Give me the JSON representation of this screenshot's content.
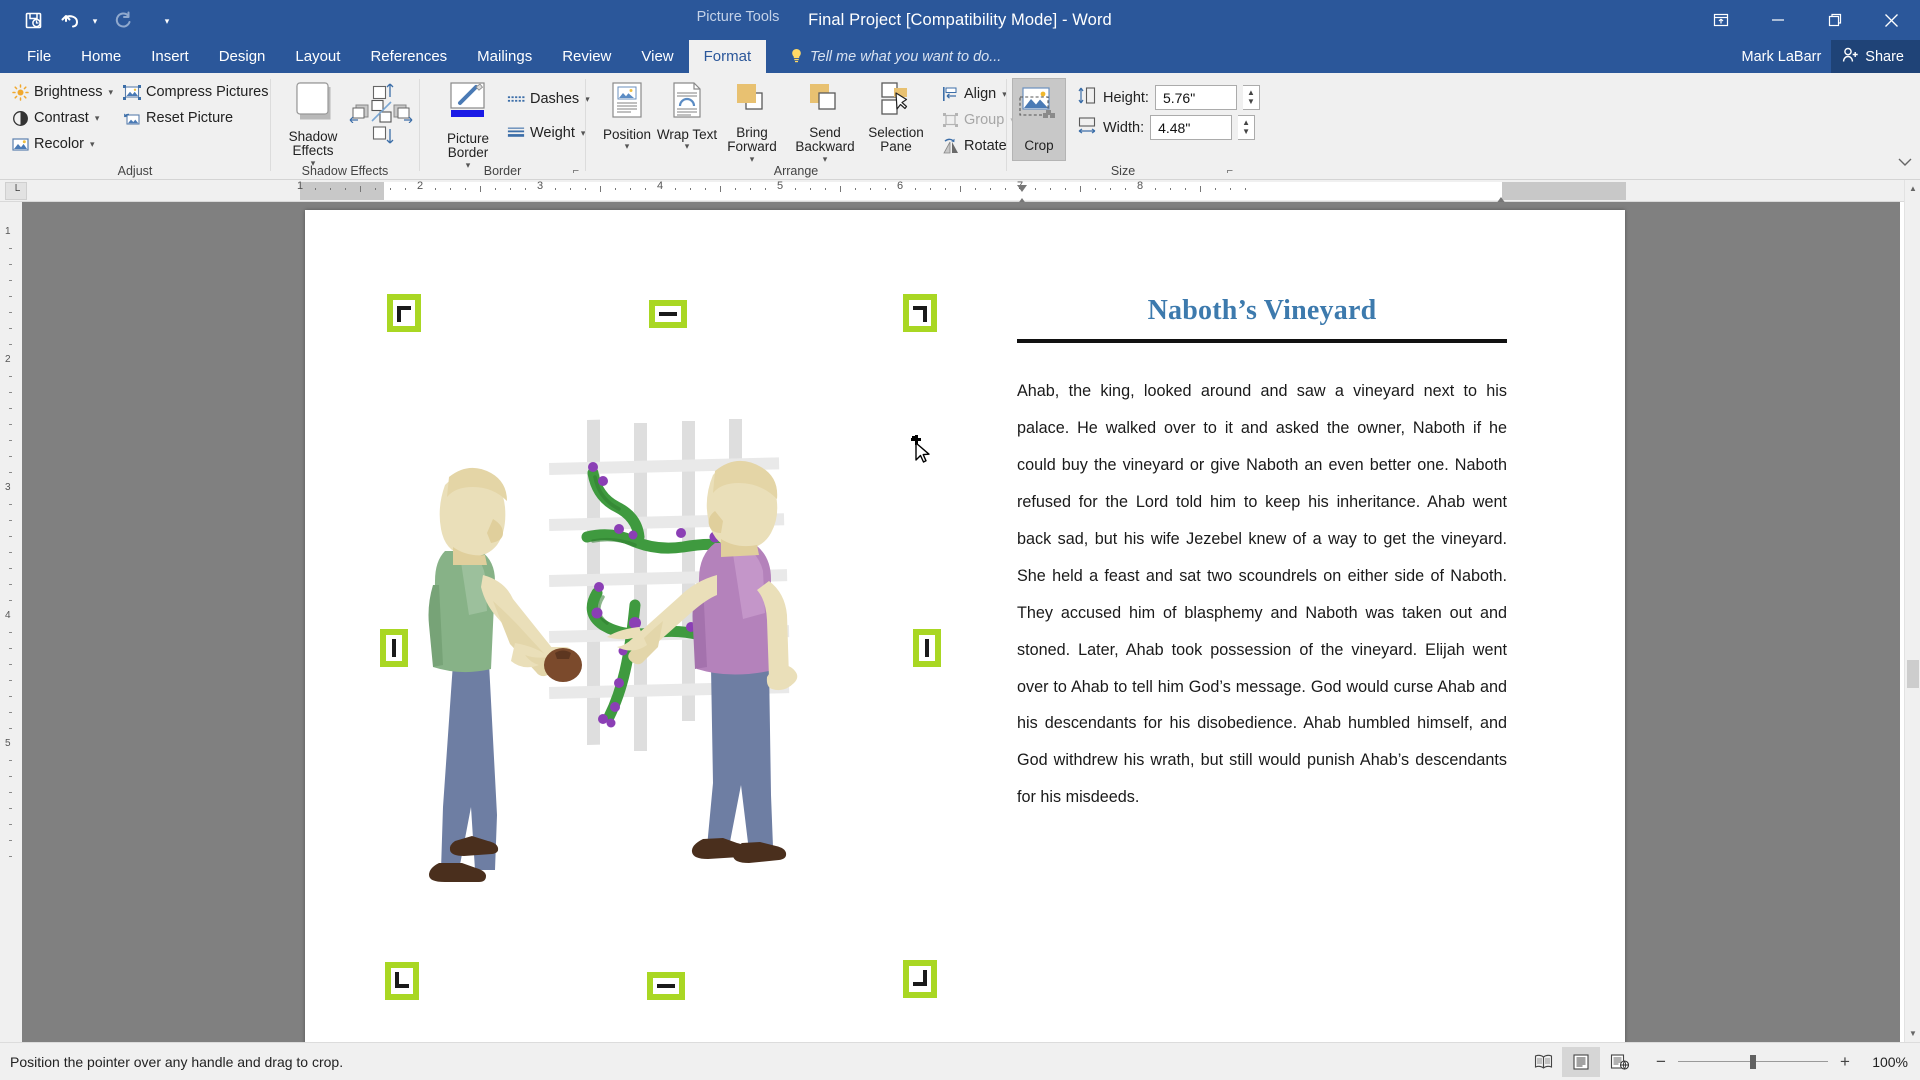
{
  "titlebar": {
    "context_tab": "Picture Tools",
    "document_title": "Final Project [Compatibility Mode] - Word",
    "qat": [
      {
        "name": "save-icon",
        "glyph": "❐"
      },
      {
        "name": "undo-icon",
        "glyph": "↶"
      },
      {
        "name": "redo-icon",
        "glyph": "↻"
      },
      {
        "name": "customize-quick-access-toolbar-icon",
        "glyph": "⌄"
      }
    ],
    "window_buttons": [
      "ribbon-display-options",
      "minimize",
      "restore",
      "close"
    ]
  },
  "tabs": [
    {
      "label": "File",
      "active": false
    },
    {
      "label": "Home",
      "active": false
    },
    {
      "label": "Insert",
      "active": false
    },
    {
      "label": "Design",
      "active": false
    },
    {
      "label": "Layout",
      "active": false
    },
    {
      "label": "References",
      "active": false
    },
    {
      "label": "Mailings",
      "active": false
    },
    {
      "label": "Review",
      "active": false
    },
    {
      "label": "View",
      "active": false
    },
    {
      "label": "Format",
      "active": true
    }
  ],
  "tellme": {
    "placeholder": "Tell me what you want to do..."
  },
  "account": {
    "user_name": "Mark LaBarr",
    "share_label": "Share"
  },
  "ribbon": {
    "groups": [
      {
        "name": "adjust",
        "label": "Adjust",
        "commands": [
          {
            "label": "Brightness",
            "icon": "brightness-icon",
            "has_dropdown": true
          },
          {
            "label": "Contrast",
            "icon": "contrast-icon",
            "has_dropdown": true
          },
          {
            "label": "Recolor",
            "icon": "recolor-icon",
            "has_dropdown": true
          },
          {
            "label": "Compress Pictures",
            "icon": "compress-pictures-icon",
            "has_dropdown": false
          },
          {
            "label": "Reset Picture",
            "icon": "reset-picture-icon",
            "has_dropdown": false
          }
        ]
      },
      {
        "name": "shadow-effects",
        "label": "Shadow Effects",
        "commands": [
          {
            "label": "Shadow Effects",
            "icon": "shadow-effects-icon",
            "has_dropdown": true
          }
        ],
        "nudge": [
          "nudge-shadow-up",
          "nudge-shadow-left",
          "shadow-on-off",
          "nudge-shadow-right",
          "nudge-shadow-down"
        ]
      },
      {
        "name": "border",
        "label": "Border",
        "commands": [
          {
            "label": "Picture Border",
            "icon": "picture-border-icon",
            "has_dropdown": true
          },
          {
            "label": "Dashes",
            "icon": "dashes-icon",
            "has_dropdown": true
          },
          {
            "label": "Weight",
            "icon": "weight-icon",
            "has_dropdown": true
          }
        ]
      },
      {
        "name": "arrange",
        "label": "Arrange",
        "commands": [
          {
            "label": "Position",
            "icon": "position-icon",
            "has_dropdown": true
          },
          {
            "label": "Wrap Text",
            "icon": "wrap-text-icon",
            "has_dropdown": true
          },
          {
            "label": "Bring Forward",
            "icon": "bring-forward-icon",
            "has_dropdown": true
          },
          {
            "label": "Send Backward",
            "icon": "send-backward-icon",
            "has_dropdown": true
          },
          {
            "label": "Selection Pane",
            "icon": "selection-pane-icon",
            "has_dropdown": false
          },
          {
            "label": "Align",
            "icon": "align-icon",
            "has_dropdown": true
          },
          {
            "label": "Group",
            "icon": "group-icon",
            "has_dropdown": true,
            "disabled": true
          },
          {
            "label": "Rotate",
            "icon": "rotate-icon",
            "has_dropdown": true
          }
        ]
      },
      {
        "name": "size",
        "label": "Size",
        "crop_label": "Crop",
        "crop_active": true,
        "height_label": "Height:",
        "height_value": "5.76\"",
        "width_label": "Width:",
        "width_value": "4.48\""
      }
    ]
  },
  "ruler": {
    "tab_stop_glyph": "└",
    "horizontal_marks": [
      "1",
      "2",
      "3",
      "4",
      "5",
      "6",
      "7",
      "8"
    ],
    "vertical_marks": [
      "1",
      "2",
      "3",
      "4",
      "5"
    ]
  },
  "document": {
    "title": "Naboth’s Vineyard",
    "body": "Ahab, the king, looked around and saw a vineyard next to his palace. He walked over to it and asked the owner, Naboth if he could buy the vineyard or give Naboth an even better one. Naboth refused for the Lord told him to keep his inheritance. Ahab went back sad, but his wife Jezebel knew of a way to get the vineyard. She held a feast and sat two scoundrels on either side of Naboth. They accused him of blasphemy and Naboth was taken out and stoned. Later, Ahab took possession of the vineyard. Elijah went over to Ahab to tell him God’s message. God would curse Ahab and his descendants for his disobedience. Ahab humbled himself, and God withdrew his wrath, but still would punish Ahab’s descendants for his misdeeds.",
    "image": {
      "name": "naboth-vineyard-illustration",
      "description": "Two illustrated figures: a man in a green shirt holding a brown object, and a man in a purple shirt tending a grapevine on a white trellis",
      "selected": true,
      "crop_mode": true,
      "handle_color": "#a9d723"
    }
  },
  "statusbar": {
    "message": "Position the pointer over any handle and drag to crop.",
    "views": [
      {
        "name": "read-mode-view-button",
        "active": false
      },
      {
        "name": "print-layout-view-button",
        "active": true
      },
      {
        "name": "web-layout-view-button",
        "active": false
      }
    ],
    "zoom_out_label": "−",
    "zoom_in_label": "+",
    "zoom_level": "100%"
  },
  "colors": {
    "word_blue": "#2b579a",
    "title_blue": "#3d7aad",
    "crop_handle_green": "#a9d723",
    "ribbon_bg": "#f0f0f0",
    "page_bg_gray": "#808080"
  }
}
